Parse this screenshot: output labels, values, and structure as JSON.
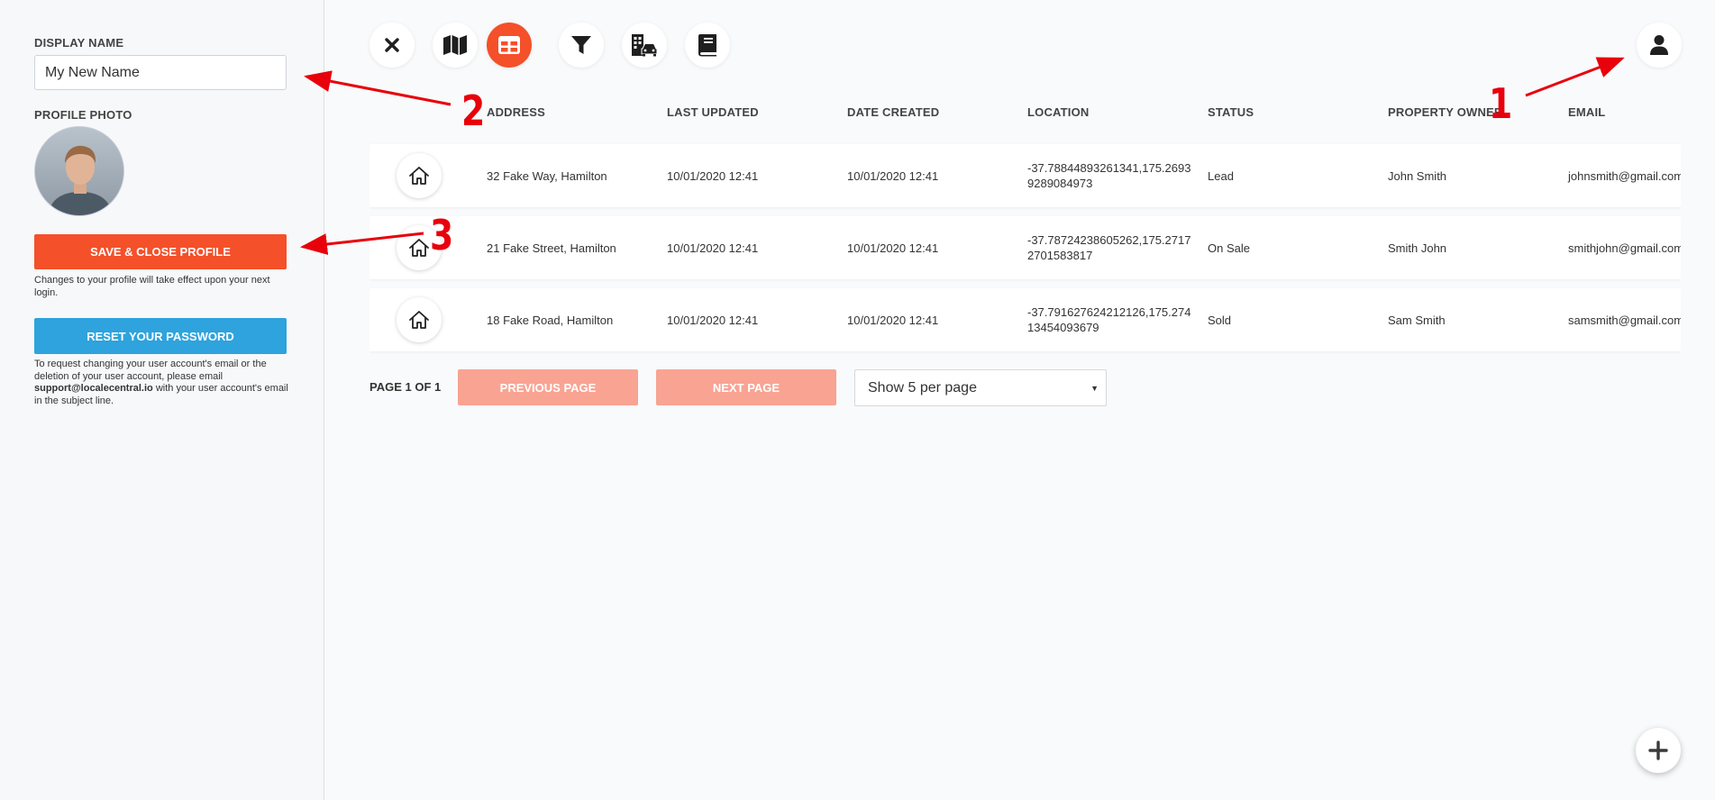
{
  "sidebar": {
    "display_name_label": "DISPLAY NAME",
    "display_name_value": "My New Name",
    "profile_photo_label": "PROFILE PHOTO",
    "save_button": "SAVE & CLOSE PROFILE",
    "save_note": "Changes to your profile will take effect upon your next login.",
    "reset_button": "RESET YOUR PASSWORD",
    "request_note_prefix": "To request changing your user account's email or the deletion of your user account, please email ",
    "support_email": "support@localecentral.io",
    "request_note_suffix": " with your user account's email in the subject line."
  },
  "toolbar": {
    "buttons": [
      {
        "icon": "close-icon",
        "active": false
      },
      {
        "icon": "map-icon",
        "active": false
      },
      {
        "icon": "table-icon",
        "active": true
      },
      {
        "icon": "filter-icon",
        "active": false
      },
      {
        "icon": "building-car-icon",
        "active": false
      },
      {
        "icon": "book-icon",
        "active": false
      }
    ],
    "accent_color": "#f4502a"
  },
  "table": {
    "columns": [
      "ADDRESS",
      "LAST UPDATED",
      "DATE CREATED",
      "LOCATION",
      "STATUS",
      "PROPERTY OWNER",
      "EMAIL"
    ],
    "rows": [
      {
        "address": "32 Fake Way, Hamilton",
        "last_updated": "10/01/2020 12:41",
        "date_created": "10/01/2020 12:41",
        "location": "-37.78844893261341,175.26939289084973",
        "status": "Lead",
        "owner": "John Smith",
        "email": "johnsmith@gmail.com"
      },
      {
        "address": "21 Fake Street, Hamilton",
        "last_updated": "10/01/2020 12:41",
        "date_created": "10/01/2020 12:41",
        "location": "-37.78724238605262,175.27172701583817",
        "status": "On Sale",
        "owner": "Smith John",
        "email": "smithjohn@gmail.com"
      },
      {
        "address": "18 Fake Road, Hamilton",
        "last_updated": "10/01/2020 12:41",
        "date_created": "10/01/2020 12:41",
        "location": "-37.791627624212126,175.27413454093679",
        "status": "Sold",
        "owner": "Sam Smith",
        "email": "samsmith@gmail.com"
      }
    ]
  },
  "pagination": {
    "label": "PAGE 1 OF 1",
    "previous": "PREVIOUS PAGE",
    "next": "NEXT PAGE",
    "per_page": "Show 5 per page"
  },
  "annotations": {
    "numbers": [
      "1",
      "2",
      "3"
    ],
    "color": "#e8000b"
  }
}
